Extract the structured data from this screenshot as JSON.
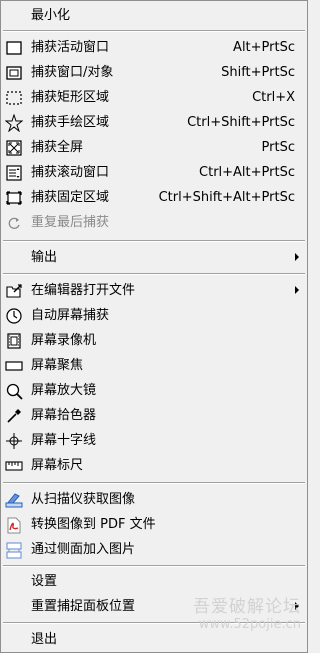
{
  "menu": {
    "minimize": "最小化",
    "capture_active_window": {
      "label": "捕获活动窗口",
      "shortcut": "Alt+PrtSc",
      "icon": "window-icon"
    },
    "capture_window_object": {
      "label": "捕获窗口/对象",
      "shortcut": "Shift+PrtSc",
      "icon": "window-object-icon"
    },
    "capture_rectangle": {
      "label": "捕获矩形区域",
      "shortcut": "Ctrl+X",
      "icon": "dashed-rect-icon"
    },
    "capture_freehand": {
      "label": "捕获手绘区域",
      "shortcut": "Ctrl+Shift+PrtSc",
      "icon": "star-freehand-icon"
    },
    "capture_fullscreen": {
      "label": "捕获全屏",
      "shortcut": "PrtSc",
      "icon": "fullscreen-icon"
    },
    "capture_scrolling": {
      "label": "捕获滚动窗口",
      "shortcut": "Ctrl+Alt+PrtSc",
      "icon": "scroll-window-icon"
    },
    "capture_fixed": {
      "label": "捕获固定区域",
      "shortcut": "Ctrl+Shift+Alt+PrtSc",
      "icon": "fixed-region-icon"
    },
    "repeat_last": {
      "label": "重复最后捕获",
      "icon": "repeat-icon"
    },
    "output": "输出",
    "open_in_editor": {
      "label": "在编辑器打开文件",
      "icon": "open-editor-icon"
    },
    "auto_capture": {
      "label": "自动屏幕捕获",
      "icon": "clock-icon"
    },
    "screen_recorder": {
      "label": "屏幕录像机",
      "icon": "film-icon"
    },
    "screen_focus": {
      "label": "屏幕聚焦",
      "icon": "focus-icon"
    },
    "screen_magnifier": {
      "label": "屏幕放大镜",
      "icon": "magnifier-icon"
    },
    "color_picker": {
      "label": "屏幕拾色器",
      "icon": "eyedropper-icon"
    },
    "crosshair": {
      "label": "屏幕十字线",
      "icon": "crosshair-icon"
    },
    "ruler": {
      "label": "屏幕标尺",
      "icon": "ruler-icon"
    },
    "from_scanner": {
      "label": "从扫描仪获取图像",
      "icon": "scanner-icon"
    },
    "to_pdf": {
      "label": "转换图像到 PDF 文件",
      "icon": "pdf-icon"
    },
    "join_images": {
      "label": "通过侧面加入图片",
      "icon": "join-images-icon"
    },
    "settings": "设置",
    "reset_panel": "重置捕捉面板位置",
    "exit": "退出"
  },
  "watermark": {
    "line1": "吾爱破解论坛",
    "line2": "www.52pojie.cn"
  },
  "colors": {
    "background": "#f0f0f0",
    "separator": "#a0a0a0",
    "disabled": "#8a8a8a",
    "accent_blue": "#1f5fbf",
    "pdf_red": "#d42a20"
  }
}
